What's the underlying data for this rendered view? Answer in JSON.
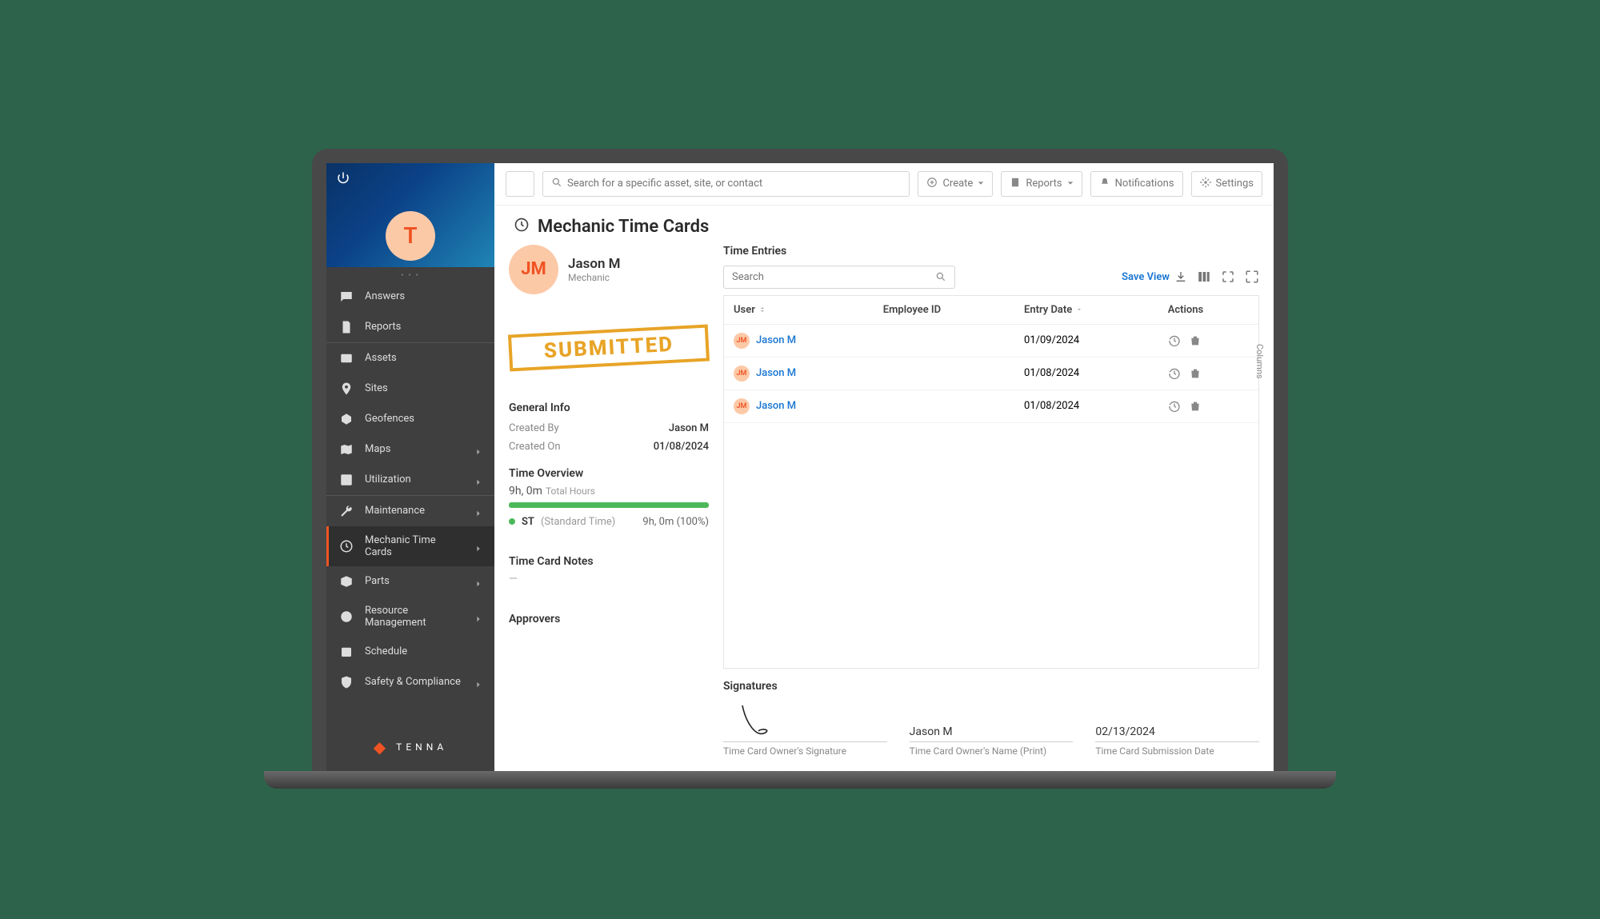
{
  "sidebar": {
    "avatar_initial": "T",
    "items": [
      {
        "label": "Answers"
      },
      {
        "label": "Reports"
      },
      {
        "label": "Assets"
      },
      {
        "label": "Sites"
      },
      {
        "label": "Geofences"
      },
      {
        "label": "Maps"
      },
      {
        "label": "Utilization"
      },
      {
        "label": "Maintenance"
      },
      {
        "label": "Mechanic Time Cards"
      },
      {
        "label": "Parts"
      },
      {
        "label": "Resource Management"
      },
      {
        "label": "Schedule"
      },
      {
        "label": "Safety & Compliance"
      }
    ],
    "brand": "TENNA"
  },
  "topbar": {
    "search_placeholder": "Search for a specific asset, site, or contact",
    "create": "Create",
    "reports": "Reports",
    "notifications": "Notifications",
    "settings": "Settings"
  },
  "page": {
    "title": "Mechanic Time Cards"
  },
  "profile": {
    "initials": "JM",
    "name": "Jason M",
    "role": "Mechanic",
    "stamp": "SUBMITTED"
  },
  "general": {
    "heading": "General Info",
    "created_by_label": "Created By",
    "created_by": "Jason M",
    "created_on_label": "Created On",
    "created_on": "01/08/2024"
  },
  "overview": {
    "heading": "Time Overview",
    "total": "9h, 0m",
    "total_label": "Total Hours",
    "st_code": "ST",
    "st_desc": "(Standard Time)",
    "st_value": "9h, 0m (100%)"
  },
  "notes": {
    "heading": "Time Card Notes",
    "value": "—"
  },
  "approvers": {
    "heading": "Approvers"
  },
  "entries": {
    "heading": "Time Entries",
    "search_placeholder": "Search",
    "save_view": "Save View",
    "columns_label": "Columns",
    "cols": {
      "user": "User",
      "employee_id": "Employee ID",
      "entry_date": "Entry Date",
      "actions": "Actions"
    },
    "rows": [
      {
        "initials": "JM",
        "user": "Jason M",
        "employee_id": "",
        "entry_date": "01/09/2024"
      },
      {
        "initials": "JM",
        "user": "Jason M",
        "employee_id": "",
        "entry_date": "01/08/2024"
      },
      {
        "initials": "JM",
        "user": "Jason M",
        "employee_id": "",
        "entry_date": "01/08/2024"
      }
    ]
  },
  "sigs": {
    "heading": "Signatures",
    "owner_sig_label": "Time Card Owner's Signature",
    "owner_name_label": "Time Card Owner's Name (Print)",
    "owner_name": "Jason M",
    "submit_date_label": "Time Card Submission Date",
    "submit_date": "02/13/2024"
  }
}
